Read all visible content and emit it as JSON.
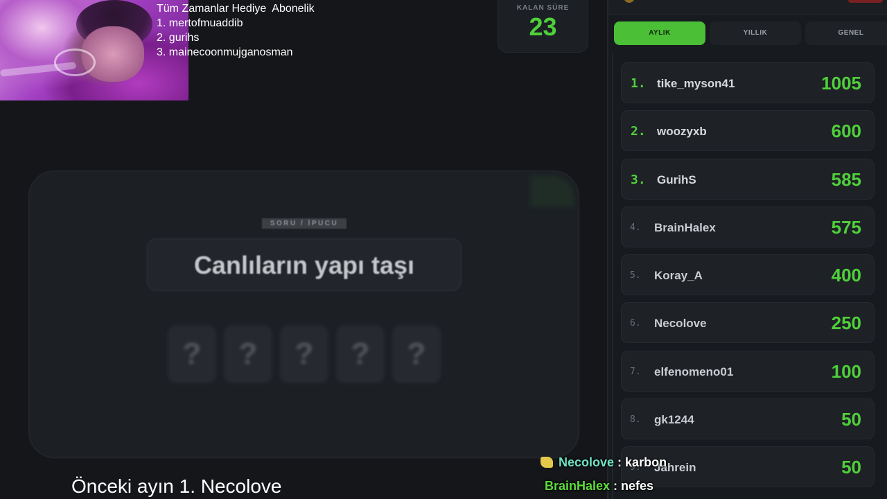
{
  "top_list": {
    "title": "Tüm Zamanlar Hediye  Abonelik",
    "items": [
      "1. mertofmuaddib",
      "2. gurihs",
      "3. mainecoonmujganosman"
    ]
  },
  "timer": {
    "label": "KALAN SÜRE",
    "value": "23"
  },
  "question": {
    "label": "SORU / İPUCU",
    "text": "Canlıların yapı taşı",
    "letters": [
      "?",
      "?",
      "?",
      "?",
      "?"
    ]
  },
  "bottom_caption": "Önceki ayın 1. Necolove",
  "leaderboard": {
    "tabs": [
      {
        "label": "AYLIK",
        "active": true
      },
      {
        "label": "YILLIK",
        "active": false
      },
      {
        "label": "GENEL",
        "active": false
      }
    ],
    "rows": [
      {
        "rank": "1.",
        "name": "tike_myson41",
        "score": "1005"
      },
      {
        "rank": "2.",
        "name": "woozyxb",
        "score": "600"
      },
      {
        "rank": "3.",
        "name": "GurihS",
        "score": "585"
      },
      {
        "rank": "4.",
        "name": "BrainHalex",
        "score": "575"
      },
      {
        "rank": "5.",
        "name": "Koray_A",
        "score": "400"
      },
      {
        "rank": "6.",
        "name": "Necolove",
        "score": "250"
      },
      {
        "rank": "7.",
        "name": "elfenomeno01",
        "score": "100"
      },
      {
        "rank": "8.",
        "name": "gk1244",
        "score": "50"
      },
      {
        "rank": "9.",
        "name": "Jahrein",
        "score": "50"
      }
    ]
  },
  "chat": [
    {
      "user": "Necolove",
      "sep": " : ",
      "message": "karbon"
    },
    {
      "user": "BrainHalex",
      "sep": " : ",
      "message": "nefes"
    }
  ],
  "colors": {
    "accent_green": "#4fd03a",
    "background": "#141619"
  }
}
